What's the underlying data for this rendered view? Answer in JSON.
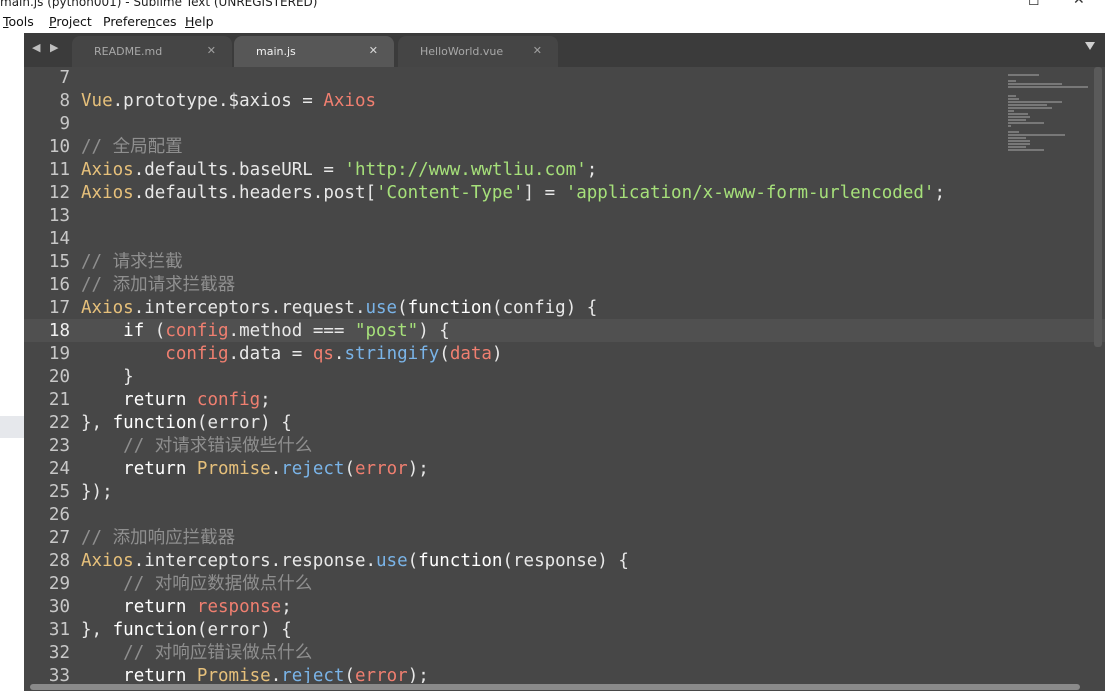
{
  "window": {
    "title": "main.js (python001) - Sublime Text (UNREGISTERED)",
    "maximize_glyph": "◻",
    "close_glyph": "✕"
  },
  "menu": {
    "items": [
      {
        "accel": "T",
        "rest": "ools"
      },
      {
        "accel": "P",
        "rest": "roject"
      },
      {
        "accel": "n",
        "pre": "Prefere",
        "rest": "ces"
      },
      {
        "accel": "H",
        "rest": "elp"
      }
    ]
  },
  "tabs": {
    "nav_arrows": "◀ ▶",
    "items": [
      {
        "label": "README.md",
        "close": "✕",
        "active": false
      },
      {
        "label": "main.js",
        "close": "✕",
        "active": true
      },
      {
        "label": "HelloWorld.vue",
        "close": "✕",
        "active": false
      }
    ]
  },
  "editor": {
    "current_line": 18,
    "lines": [
      {
        "n": "7",
        "t": []
      },
      {
        "n": "8",
        "t": [
          [
            "obj",
            "Vue"
          ],
          [
            "op",
            "."
          ],
          [
            "op",
            "prototype"
          ],
          [
            "op",
            "."
          ],
          [
            "op",
            "$axios"
          ],
          [
            "op",
            " = "
          ],
          [
            "var",
            "Axios"
          ]
        ]
      },
      {
        "n": "9",
        "t": []
      },
      {
        "n": "10",
        "t": [
          [
            "cm",
            "// 全局配置"
          ]
        ]
      },
      {
        "n": "11",
        "t": [
          [
            "obj",
            "Axios"
          ],
          [
            "op",
            ".defaults.baseURL = "
          ],
          [
            "str",
            "'http://www.wwtliu.com'"
          ],
          [
            "op",
            ";"
          ]
        ]
      },
      {
        "n": "12",
        "t": [
          [
            "obj",
            "Axios"
          ],
          [
            "op",
            ".defaults.headers.post["
          ],
          [
            "str",
            "'Content-Type'"
          ],
          [
            "op",
            "] = "
          ],
          [
            "str",
            "'application/x-www-form-urlencoded'"
          ],
          [
            "op",
            ";"
          ]
        ]
      },
      {
        "n": "13",
        "t": []
      },
      {
        "n": "14",
        "t": []
      },
      {
        "n": "15",
        "t": [
          [
            "cm",
            "// 请求拦截"
          ]
        ]
      },
      {
        "n": "16",
        "t": [
          [
            "cm",
            "// 添加请求拦截器"
          ]
        ]
      },
      {
        "n": "17",
        "t": [
          [
            "obj",
            "Axios"
          ],
          [
            "op",
            ".interceptors.request."
          ],
          [
            "fn",
            "use"
          ],
          [
            "op",
            "("
          ],
          [
            "kw",
            "function"
          ],
          [
            "op",
            "(config) {"
          ]
        ]
      },
      {
        "n": "18",
        "t": [
          [
            "op",
            "    "
          ],
          [
            "kw",
            "if"
          ],
          [
            "op",
            " ("
          ],
          [
            "var",
            "config"
          ],
          [
            "op",
            ".method === "
          ],
          [
            "str",
            "\"post\""
          ],
          [
            "op",
            ") {"
          ]
        ]
      },
      {
        "n": "19",
        "t": [
          [
            "op",
            "        "
          ],
          [
            "var",
            "config"
          ],
          [
            "op",
            ".data = "
          ],
          [
            "var",
            "qs"
          ],
          [
            "op",
            "."
          ],
          [
            "fn",
            "stringify"
          ],
          [
            "op",
            "("
          ],
          [
            "var",
            "data"
          ],
          [
            "op",
            ")"
          ]
        ]
      },
      {
        "n": "20",
        "t": [
          [
            "op",
            "    }"
          ]
        ]
      },
      {
        "n": "21",
        "t": [
          [
            "op",
            "    "
          ],
          [
            "kw",
            "return"
          ],
          [
            "op",
            " "
          ],
          [
            "var",
            "config"
          ],
          [
            "op",
            ";"
          ]
        ]
      },
      {
        "n": "22",
        "t": [
          [
            "op",
            "}, "
          ],
          [
            "kw",
            "function"
          ],
          [
            "op",
            "(error) {"
          ]
        ]
      },
      {
        "n": "23",
        "t": [
          [
            "op",
            "    "
          ],
          [
            "cm",
            "// 对请求错误做些什么"
          ]
        ]
      },
      {
        "n": "24",
        "t": [
          [
            "op",
            "    "
          ],
          [
            "kw",
            "return"
          ],
          [
            "op",
            " "
          ],
          [
            "obj",
            "Promise"
          ],
          [
            "op",
            "."
          ],
          [
            "fn",
            "reject"
          ],
          [
            "op",
            "("
          ],
          [
            "var",
            "error"
          ],
          [
            "op",
            ");"
          ]
        ]
      },
      {
        "n": "25",
        "t": [
          [
            "op",
            "});"
          ]
        ]
      },
      {
        "n": "26",
        "t": []
      },
      {
        "n": "27",
        "t": [
          [
            "cm",
            "// 添加响应拦截器"
          ]
        ]
      },
      {
        "n": "28",
        "t": [
          [
            "obj",
            "Axios"
          ],
          [
            "op",
            ".interceptors.response."
          ],
          [
            "fn",
            "use"
          ],
          [
            "op",
            "("
          ],
          [
            "kw",
            "function"
          ],
          [
            "op",
            "(response) {"
          ]
        ]
      },
      {
        "n": "29",
        "t": [
          [
            "op",
            "    "
          ],
          [
            "cm",
            "// 对响应数据做点什么"
          ]
        ]
      },
      {
        "n": "30",
        "t": [
          [
            "op",
            "    "
          ],
          [
            "kw",
            "return"
          ],
          [
            "op",
            " "
          ],
          [
            "var",
            "response"
          ],
          [
            "op",
            ";"
          ]
        ]
      },
      {
        "n": "31",
        "t": [
          [
            "op",
            "}, "
          ],
          [
            "kw",
            "function"
          ],
          [
            "op",
            "(error) {"
          ]
        ]
      },
      {
        "n": "32",
        "t": [
          [
            "op",
            "    "
          ],
          [
            "cm",
            "// 对响应错误做点什么"
          ]
        ]
      },
      {
        "n": "33",
        "t": [
          [
            "op",
            "    "
          ],
          [
            "kw",
            "return"
          ],
          [
            "op",
            " "
          ],
          [
            "obj",
            "Promise"
          ],
          [
            "op",
            "."
          ],
          [
            "fn",
            "reject"
          ],
          [
            "op",
            "("
          ],
          [
            "var",
            "error"
          ],
          [
            "op",
            ");"
          ]
        ]
      }
    ]
  }
}
